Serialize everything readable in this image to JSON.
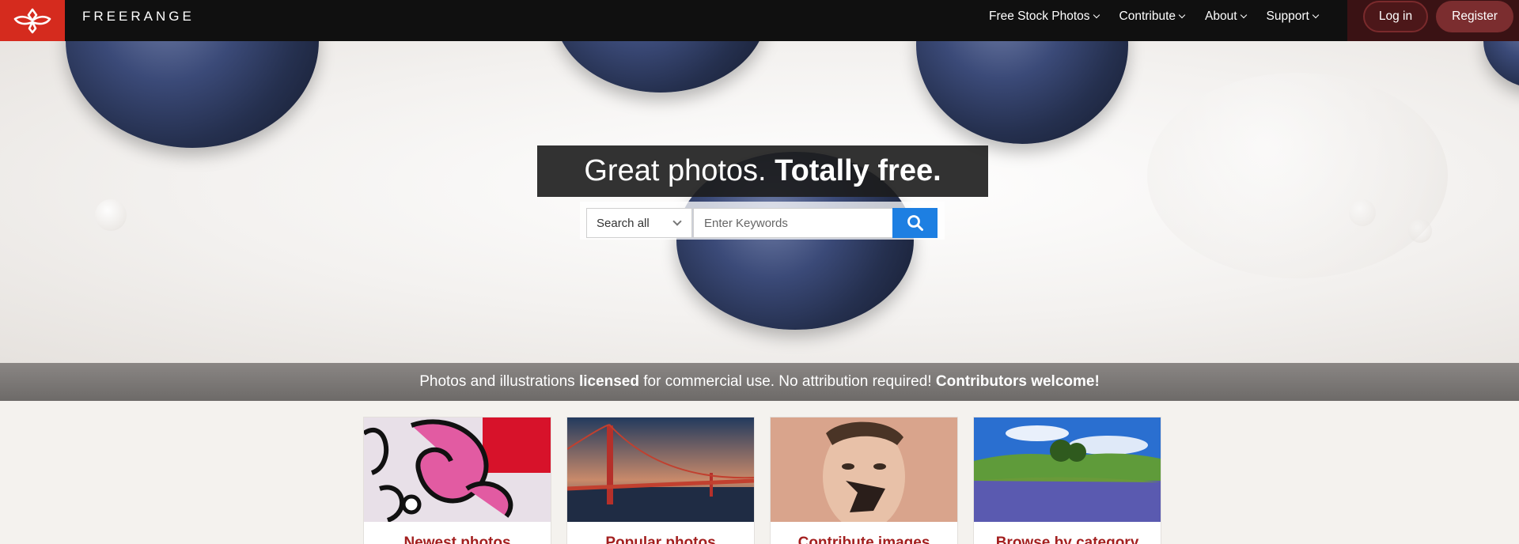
{
  "brand": {
    "name": "FREERANGE",
    "logo_icon": "freerange-leaf-logo-icon",
    "logo_color": "#d52b1e"
  },
  "nav": {
    "items": [
      {
        "label": "Free Stock Photos"
      },
      {
        "label": "Contribute"
      },
      {
        "label": "About"
      },
      {
        "label": "Support"
      }
    ],
    "login_label": "Log in",
    "register_label": "Register"
  },
  "hero": {
    "headline_regular": "Great photos.",
    "headline_bold": "Totally free.",
    "search": {
      "scope_selected": "Search all",
      "keyword_placeholder": "Enter Keywords",
      "button_icon": "search-icon",
      "button_color": "#1d7fe2"
    }
  },
  "license_strip": {
    "part1": "Photos and illustrations",
    "part2": "licensed",
    "part3": "for commercial use. No attribution required!",
    "part4": "Contributors welcome!"
  },
  "cards": [
    {
      "title": "Newest photos"
    },
    {
      "title": "Popular photos"
    },
    {
      "title": "Contribute images"
    },
    {
      "title": "Browse by category"
    }
  ],
  "colors": {
    "accent_red": "#a31f1f",
    "auth_bg": "#3a1214",
    "register_bg": "#7b2d2f"
  }
}
